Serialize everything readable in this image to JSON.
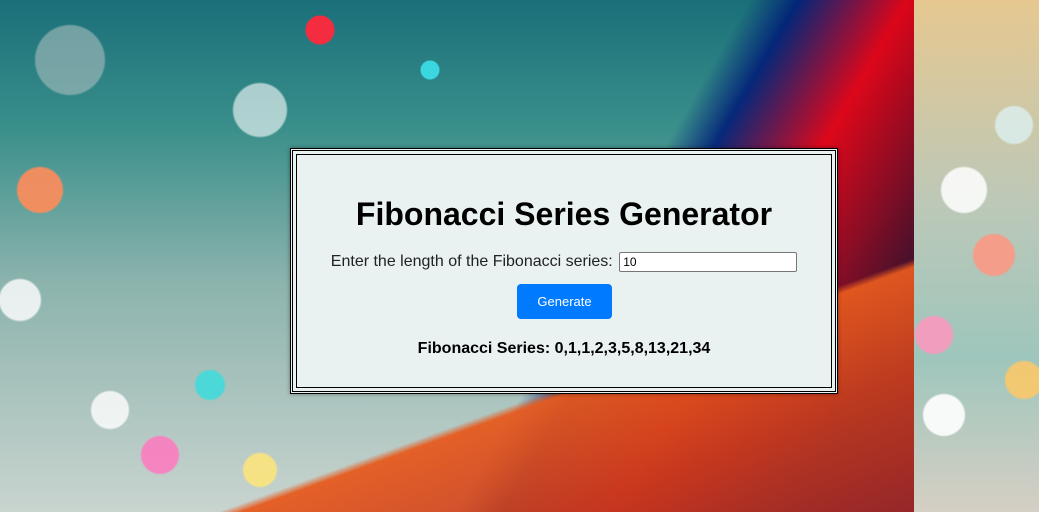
{
  "app": {
    "title": "Fibonacci Series Generator"
  },
  "form": {
    "length_label": "Enter the length of the Fibonacci series:",
    "length_value": "10",
    "generate_label": "Generate"
  },
  "result": {
    "label": "Fibonacci Series:",
    "values": "0,1,1,2,3,5,8,13,21,34"
  },
  "colors": {
    "button_bg": "#007bff",
    "card_bg": "#e9f1f1"
  }
}
